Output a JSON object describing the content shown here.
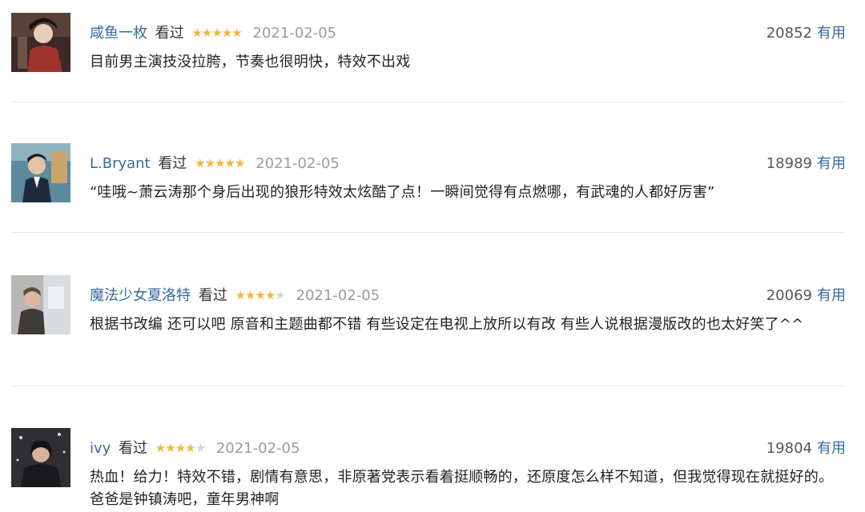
{
  "reviews": [
    {
      "user": "咸鱼一枚",
      "status": "看过",
      "rating": 5,
      "date": "2021-02-05",
      "votes": "20852",
      "useful_label": "有用",
      "content": "目前男主演技没拉胯，节奏也很明快，特效不出戏"
    },
    {
      "user": "L.Bryant",
      "status": "看过",
      "rating": 5,
      "date": "2021-02-05",
      "votes": "18989",
      "useful_label": "有用",
      "content": "“哇哦~萧云涛那个身后出现的狼形特效太炫酷了点！一瞬间觉得有点燃哪，有武魂的人都好厉害”"
    },
    {
      "user": "魔法少女夏洛特",
      "status": "看过",
      "rating": 4,
      "date": "2021-02-05",
      "votes": "20069",
      "useful_label": "有用",
      "content": "根据书改编 还可以吧 原音和主题曲都不错 有些设定在电视上放所以有改 有些人说根据漫版改的也太好笑了^^"
    },
    {
      "user": "ivy",
      "status": "看过",
      "rating": 4,
      "date": "2021-02-05",
      "votes": "19804",
      "useful_label": "有用",
      "content": "热血！给力！特效不错，剧情有意思，非原著党表示看着挺顺畅的，还原度怎么样不知道，但我觉得现在就挺好的。爸爸是钟镇涛吧，童年男神啊"
    }
  ],
  "colors": {
    "link": "#37699f",
    "star_on": "#f6b43a",
    "star_off": "#d6d6d6",
    "date": "#9b9b9b"
  }
}
